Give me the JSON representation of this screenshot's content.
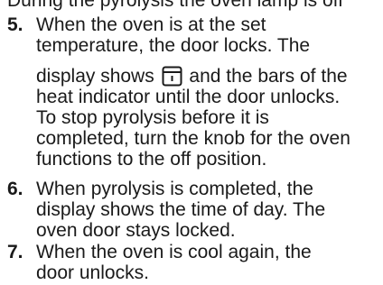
{
  "page": {
    "cut_line": "During the pyrolysis the oven lamp is off",
    "steps": [
      {
        "number": "5.",
        "lines": [
          "When the oven is at the set",
          "temperature, the door locks. The",
          "display shows",
          "and the bars of the",
          "heat indicator until the door unlocks.",
          "To stop pyrolysis before it is",
          "completed, turn the knob for the oven",
          "functions to the off position."
        ],
        "icon": "door-lock-icon"
      },
      {
        "number": "6.",
        "lines": [
          "When pyrolysis is completed, the",
          "display shows the time of day. The",
          "oven door stays locked."
        ]
      },
      {
        "number": "7.",
        "lines": [
          "When the oven is cool again, the",
          "door unlocks."
        ]
      }
    ]
  }
}
